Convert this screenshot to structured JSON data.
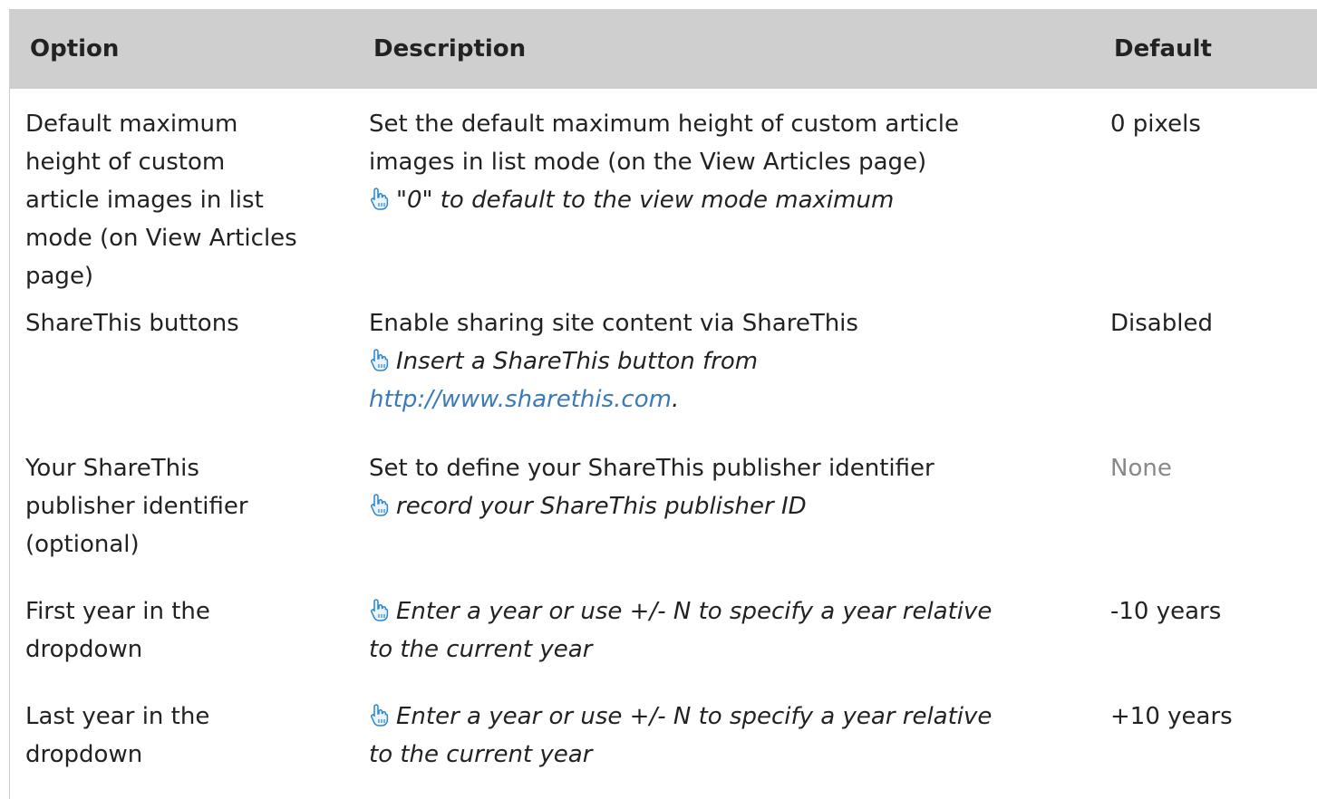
{
  "table": {
    "headers": {
      "option": "Option",
      "description": "Description",
      "default": "Default"
    },
    "rows": [
      {
        "option": [
          "Default maximum",
          "height of custom",
          "article images in list",
          "mode (on View Articles",
          "page)"
        ],
        "desc_lines": [
          "Set the default maximum height of custom article",
          "images in list mode (on the View Articles page)"
        ],
        "hint": "\"0\" to default to the view mode maximum",
        "default": "0 pixels"
      },
      {
        "option": [
          "ShareThis buttons"
        ],
        "desc_lines": [
          "Enable sharing site content via ShareThis"
        ],
        "hint": "Insert a ShareThis button from",
        "link": "http://www.sharethis.com",
        "link_suffix": ".",
        "default": "Disabled"
      },
      {
        "option": [
          "Your ShareThis",
          "publisher identifier",
          "(optional)"
        ],
        "desc_lines": [
          "Set to define your ShareThis publisher identifier"
        ],
        "hint": "record your ShareThis publisher ID",
        "default": "None"
      },
      {
        "option": [
          "First year in the",
          "dropdown"
        ],
        "hint_lines": [
          "Enter a year or use +/- N to specify a year relative",
          "to the current year"
        ],
        "default": "-10 years"
      },
      {
        "option": [
          "Last year in the",
          "dropdown"
        ],
        "hint_lines": [
          "Enter a year or use +/- N to specify a year relative",
          "to the current year"
        ],
        "default": "+10 years"
      }
    ]
  },
  "icons": {
    "hint": "pointing-hand-icon"
  },
  "colors": {
    "header_bg": "#cfcfcf",
    "link": "#3a7ab8",
    "muted": "#888888",
    "hand": "#2f86c8"
  }
}
